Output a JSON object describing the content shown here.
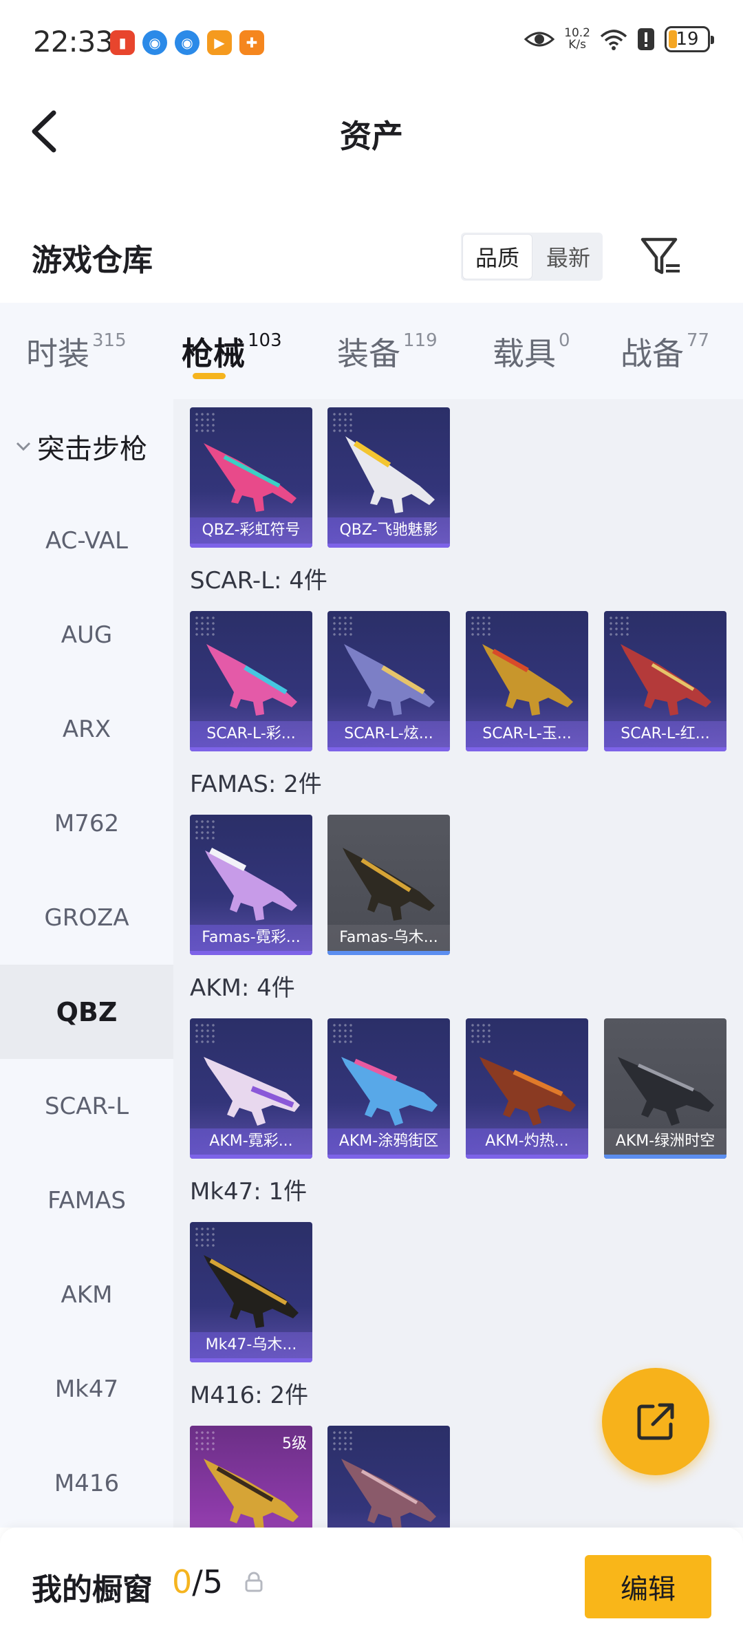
{
  "status_bar": {
    "time": "22:33",
    "net_speed_value": "10.2",
    "net_speed_unit": "K/s",
    "battery": "19",
    "app_icons": [
      "notification-red-icon",
      "browser-blue-icon",
      "browser-blue-icon",
      "video-orange-icon",
      "game-orange-icon"
    ]
  },
  "nav": {
    "title": "资产"
  },
  "section": {
    "title": "游戏仓库",
    "sort_quality": "品质",
    "sort_newest": "最新"
  },
  "tabs": [
    {
      "name": "时装",
      "count": "315"
    },
    {
      "name": "枪械",
      "count": "103"
    },
    {
      "name": "装备",
      "count": "119"
    },
    {
      "name": "载具",
      "count": "0"
    },
    {
      "name": "战备",
      "count": "77"
    }
  ],
  "sidebar": {
    "header": "突击步枪",
    "items": [
      "AC-VAL",
      "AUG",
      "ARX",
      "M762",
      "GROZA",
      "QBZ",
      "SCAR-L",
      "FAMAS",
      "AKM",
      "Mk47",
      "M416"
    ],
    "active_index": 5
  },
  "groups": {
    "qbz": {
      "cards": [
        "QBZ-彩虹符号",
        "QBZ-飞驰魅影"
      ]
    },
    "scarl": {
      "label": "SCAR-L: 4件",
      "cards": [
        "SCAR-L-彩...",
        "SCAR-L-炫...",
        "SCAR-L-玉...",
        "SCAR-L-红..."
      ]
    },
    "famas": {
      "label": "FAMAS: 2件",
      "cards": [
        "Famas-霓彩...",
        "Famas-乌木..."
      ]
    },
    "akm": {
      "label": "AKM: 4件",
      "cards": [
        "AKM-霓彩...",
        "AKM-涂鸦街区",
        "AKM-灼热...",
        "AKM-绿洲时空"
      ]
    },
    "mk47": {
      "label": "Mk47: 1件",
      "cards": [
        "Mk47-乌木..."
      ]
    },
    "m416": {
      "label": "M416: 2件",
      "level": "5级"
    }
  },
  "bottom": {
    "title": "我的橱窗",
    "current": "0",
    "total": "/5",
    "edit": "编辑"
  },
  "colors": {
    "accent": "#f5b41f",
    "card_bg": "#2b2f68",
    "gray_card": "#55575f"
  }
}
